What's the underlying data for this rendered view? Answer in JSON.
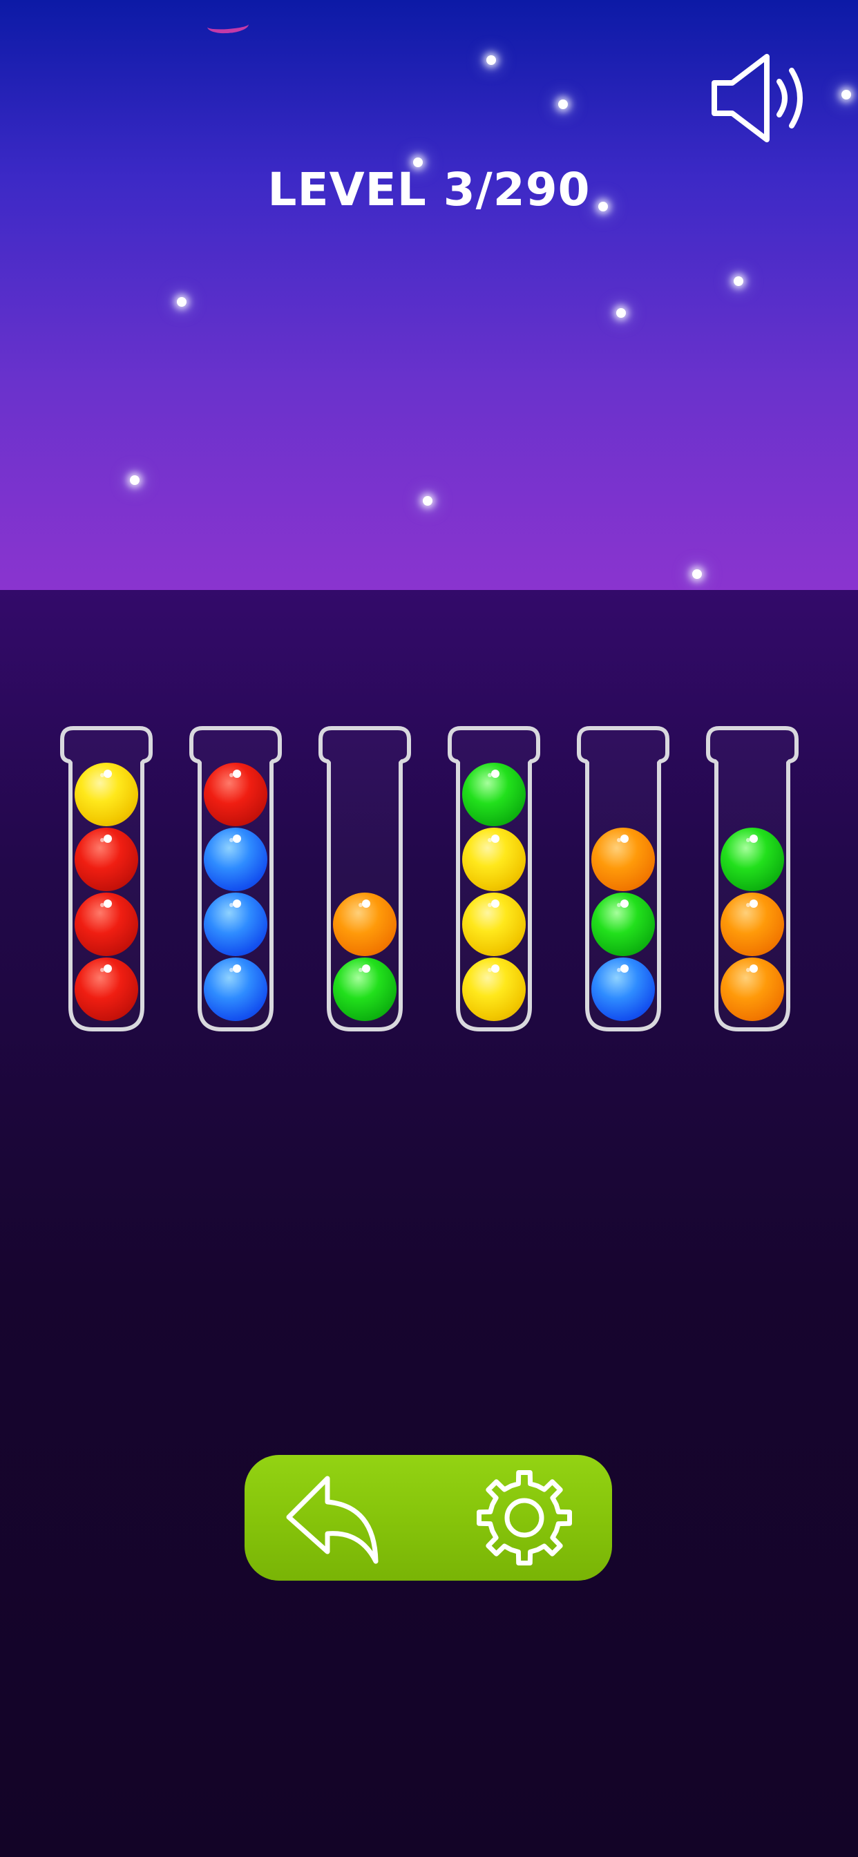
{
  "header": {
    "level_label": "LEVEL 3/290"
  },
  "icons": {
    "sound": "speaker-with-sound-waves",
    "undo": "curved-back-arrow",
    "settings": "gear"
  },
  "colors": {
    "yellow": "#ffe81c",
    "red": "#f01e12",
    "blue": "#2f8cff",
    "green": "#22e01c",
    "orange": "#ff9a0a",
    "button_green": "#85c30a",
    "tube_outline": "#d9d9de"
  },
  "tubes": [
    {
      "balls_top_to_bottom": [
        "yellow",
        "red",
        "red",
        "red"
      ]
    },
    {
      "balls_top_to_bottom": [
        "red",
        "blue",
        "blue",
        "blue"
      ]
    },
    {
      "balls_top_to_bottom": [
        "orange",
        "green"
      ]
    },
    {
      "balls_top_to_bottom": [
        "green",
        "yellow",
        "yellow",
        "yellow"
      ]
    },
    {
      "balls_top_to_bottom": [
        "orange",
        "green",
        "blue"
      ]
    },
    {
      "balls_top_to_bottom": [
        "green",
        "orange",
        "orange"
      ]
    }
  ],
  "tube_capacity": 4
}
